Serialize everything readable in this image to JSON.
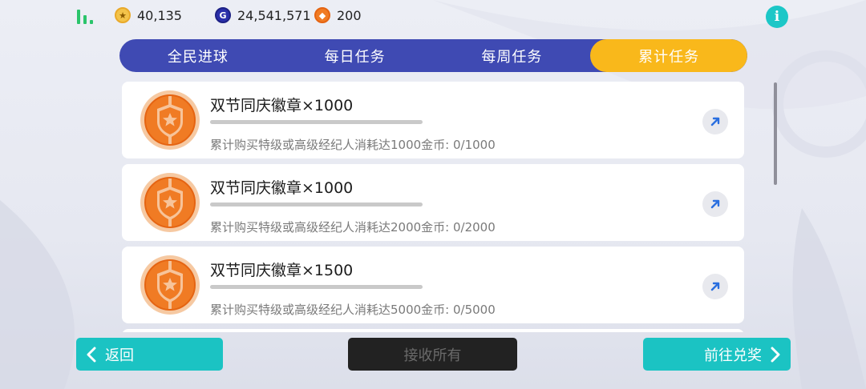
{
  "header": {
    "coins": "40,135",
    "gp": "24,541,571",
    "medals": "200",
    "gp_icon_letter": "G",
    "info_icon_letter": "i",
    "icons": [
      "signal-icon",
      "coin-icon",
      "gp-icon",
      "medal-icon",
      "info-icon"
    ]
  },
  "tabs": [
    {
      "label": "全民进球",
      "active": false
    },
    {
      "label": "每日任务",
      "active": false
    },
    {
      "label": "每周任务",
      "active": false
    },
    {
      "label": "累计任务",
      "active": true
    }
  ],
  "tasks": [
    {
      "title": "双节同庆徽章×1000",
      "desc": "累计购买特级或高级经纪人消耗达1000金币: 0/1000",
      "progress": 0
    },
    {
      "title": "双节同庆徽章×1000",
      "desc": "累计购买特级或高级经纪人消耗达2000金币: 0/2000",
      "progress": 0
    },
    {
      "title": "双节同庆徽章×1500",
      "desc": "累计购买特级或高级经纪人消耗达5000金币: 0/5000",
      "progress": 0
    }
  ],
  "footer": {
    "back_label": "返回",
    "claim_all_label": "接收所有",
    "redeem_label": "前往兑奖"
  },
  "colors": {
    "tab_bar": "#3f4ab3",
    "tab_active": "#f9b81b",
    "accent_teal": "#1bc3c3",
    "badge_orange": "#f07b24"
  }
}
